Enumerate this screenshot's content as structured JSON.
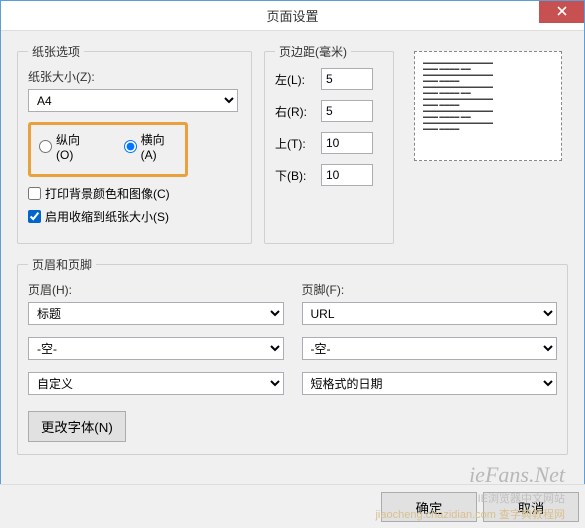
{
  "title": "页面设置",
  "paper": {
    "legend": "纸张选项",
    "size_label": "纸张大小(Z):",
    "size_value": "A4",
    "portrait_label": "纵向(O)",
    "landscape_label": "横向(A)",
    "print_bg_label": "打印背景颜色和图像(C)",
    "shrink_label": "启用收缩到纸张大小(S)"
  },
  "margins": {
    "legend": "页边距(毫米)",
    "left_label": "左(L):",
    "left_value": "5",
    "right_label": "右(R):",
    "right_value": "5",
    "top_label": "上(T):",
    "top_value": "10",
    "bottom_label": "下(B):",
    "bottom_value": "10"
  },
  "headerfooter": {
    "legend": "页眉和页脚",
    "header_label": "页眉(H):",
    "footer_label": "页脚(F):",
    "h1": "标题",
    "h2": "-空-",
    "h3": "自定义",
    "f1": "URL",
    "f2": "-空-",
    "f3": "短格式的日期",
    "font_btn": "更改字体(N)"
  },
  "buttons": {
    "ok": "确定",
    "cancel": "取消"
  },
  "watermarks": {
    "w1": "ieFans.Net",
    "w2": "IE浏览器中文网站",
    "w3": "jiaocheng.chazidian.com 查字典教程网"
  }
}
